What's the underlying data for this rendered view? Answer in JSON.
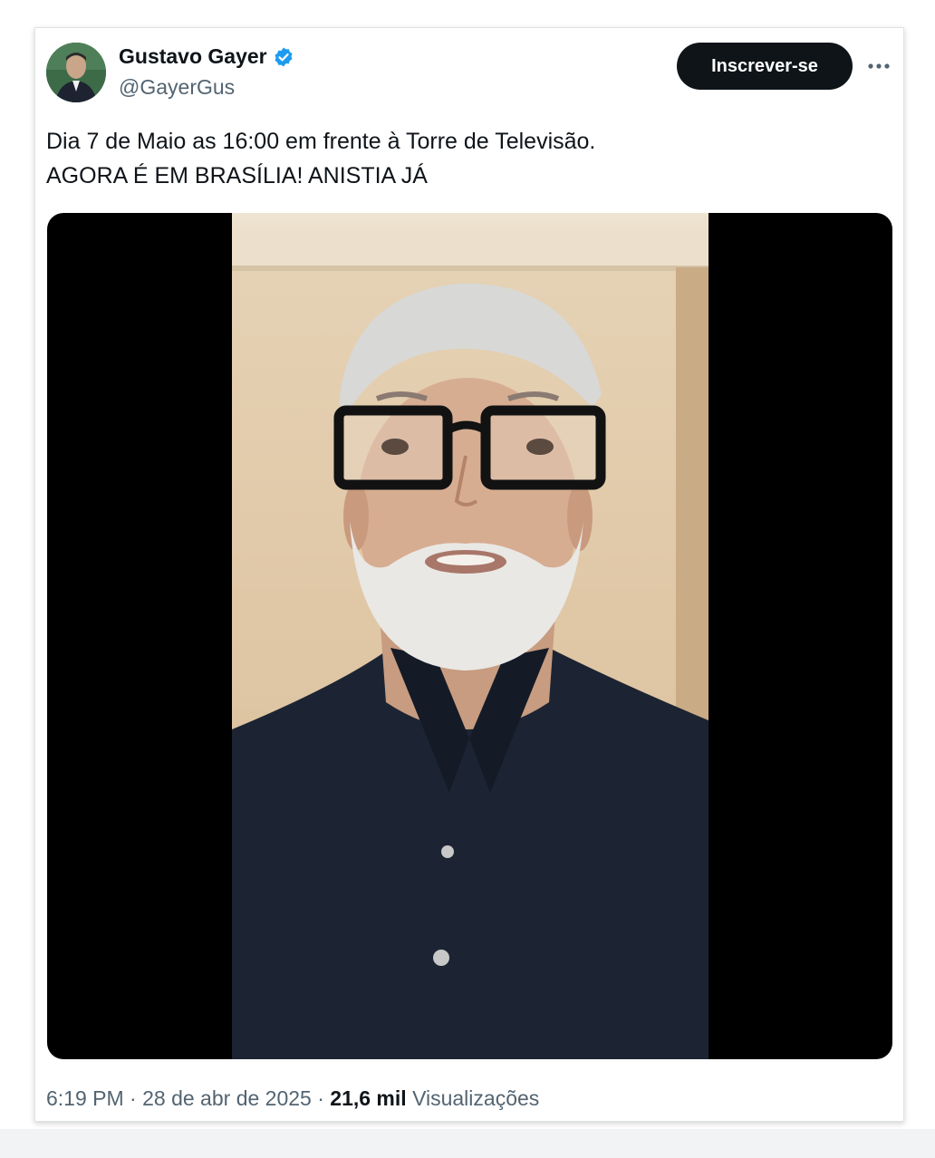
{
  "author": {
    "display_name": "Gustavo Gayer",
    "handle": "@GayerGus",
    "verified_icon": "verified-badge-icon"
  },
  "actions": {
    "subscribe_label": "Inscrever-se",
    "more_icon": "more-options-icon"
  },
  "tweet": {
    "line1": "Dia 7 de Maio as 16:00 em frente à Torre de Televisão.",
    "line2": "AGORA É EM BRASÍLIA! ANISTIA JÁ"
  },
  "meta": {
    "time": "6:19 PM",
    "separator": "·",
    "date": "28 de abr de 2025",
    "views_count": "21,6 mil",
    "views_label": "Visualizações"
  },
  "colors": {
    "text_primary": "#0f1419",
    "text_secondary": "#536471",
    "verified_blue": "#1d9bf0",
    "button_bg": "#0f1419"
  }
}
